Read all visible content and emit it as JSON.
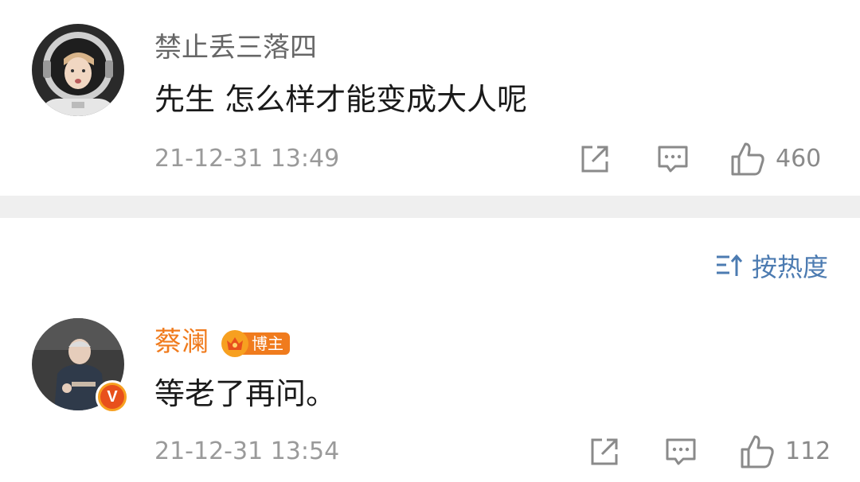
{
  "comments": [
    {
      "username": "禁止丢三落四",
      "text": "先生 怎么样才能变成大人呢",
      "time": "21-12-31 13:49",
      "likes": "460",
      "avatar_icon": "astronaut-avatar"
    },
    {
      "username": "蔡澜",
      "badge_label": "博主",
      "text": "等老了再问。",
      "time": "21-12-31 13:54",
      "likes": "112",
      "avatar_icon": "elderly-man-avatar",
      "verified_mark": "V"
    }
  ],
  "sort": {
    "label": "按热度",
    "icon": "sort-icon"
  },
  "colors": {
    "username_gray": "#666666",
    "blogger_orange": "#f07b1d",
    "link_blue": "#4c7bb1",
    "meta_gray": "#9a9a9a",
    "divider": "#efefef"
  }
}
